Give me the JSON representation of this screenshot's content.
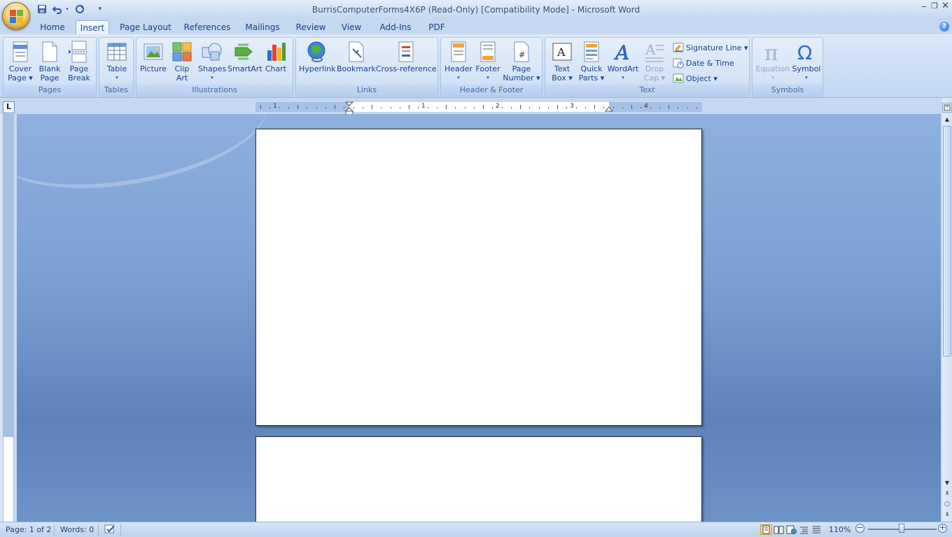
{
  "window": {
    "title": "BurrisComputerForms4X6P (Read-Only) [Compatibility Mode] - Microsoft Word",
    "minimize_glyph": "‒",
    "maximize_glyph": "❐",
    "close_glyph": "✕"
  },
  "quick_access": {
    "save_icon": "save-icon",
    "undo_icon": "undo-icon",
    "redo_icon": "redo-icon",
    "customize_icon": "customize-icon"
  },
  "tabs": [
    {
      "label": "Home",
      "active": false
    },
    {
      "label": "Insert",
      "active": true
    },
    {
      "label": "Page Layout",
      "active": false
    },
    {
      "label": "References",
      "active": false
    },
    {
      "label": "Mailings",
      "active": false
    },
    {
      "label": "Review",
      "active": false
    },
    {
      "label": "View",
      "active": false
    },
    {
      "label": "Add-Ins",
      "active": false
    },
    {
      "label": "PDF",
      "active": false
    }
  ],
  "ribbon": {
    "groups": {
      "pages": "Pages",
      "tables": "Tables",
      "illustrations": "Illustrations",
      "links": "Links",
      "header_footer": "Header & Footer",
      "text": "Text",
      "symbols": "Symbols"
    },
    "buttons": {
      "cover_page": [
        "Cover",
        "Page ▾"
      ],
      "blank_page": [
        "Blank",
        "Page"
      ],
      "page_break": [
        "Page",
        "Break"
      ],
      "table": [
        "Table",
        "▾"
      ],
      "picture": [
        "Picture"
      ],
      "clip_art": [
        "Clip",
        "Art"
      ],
      "shapes": [
        "Shapes",
        "▾"
      ],
      "smartart": [
        "SmartArt"
      ],
      "chart": [
        "Chart"
      ],
      "hyperlink": [
        "Hyperlink"
      ],
      "bookmark": [
        "Bookmark"
      ],
      "cross_reference": [
        "Cross-reference"
      ],
      "header": [
        "Header",
        "▾"
      ],
      "footer": [
        "Footer",
        "▾"
      ],
      "page_number": [
        "Page",
        "Number ▾"
      ],
      "text_box": [
        "Text",
        "Box ▾"
      ],
      "quick_parts": [
        "Quick",
        "Parts ▾"
      ],
      "wordart": [
        "WordArt",
        "▾"
      ],
      "drop_cap": [
        "Drop",
        "Cap ▾"
      ],
      "signature_line": "Signature Line ▾",
      "date_time": "Date & Time",
      "object": "Object ▾",
      "equation": [
        "Equation",
        "▾"
      ],
      "symbol": [
        "Symbol",
        "▾"
      ]
    }
  },
  "ruler": {
    "tab_selector": "L",
    "numbers": [
      "1",
      "1",
      "2",
      "3",
      "4"
    ]
  },
  "status_bar": {
    "page": "Page: 1 of 2",
    "words": "Words: 0",
    "zoom": "110%",
    "zoom_out": "−",
    "zoom_in": "+"
  },
  "colors": {
    "office_blue": "#15428b",
    "doc_background": "#7aa0d3"
  }
}
